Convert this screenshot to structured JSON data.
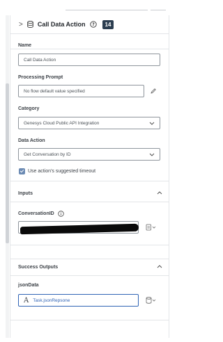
{
  "header": {
    "title": "Call Data Action",
    "badge": "14"
  },
  "fields": {
    "name_label": "Name",
    "name_value": "Call Data Action",
    "prompt_label": "Processing Prompt",
    "prompt_value": "No flow default value specified",
    "category_label": "Category",
    "category_value": "Genesys Cloud Public API Integration",
    "action_label": "Data Action",
    "action_value": "Get Conversation by ID",
    "timeout_label": "Use action's suggested timeout"
  },
  "inputs": {
    "section_label": "Inputs",
    "param_label": "ConversationID"
  },
  "outputs": {
    "section_label": "Success Outputs",
    "param_label": "jsonData",
    "param_value": "Task.jsonRepsone"
  }
}
